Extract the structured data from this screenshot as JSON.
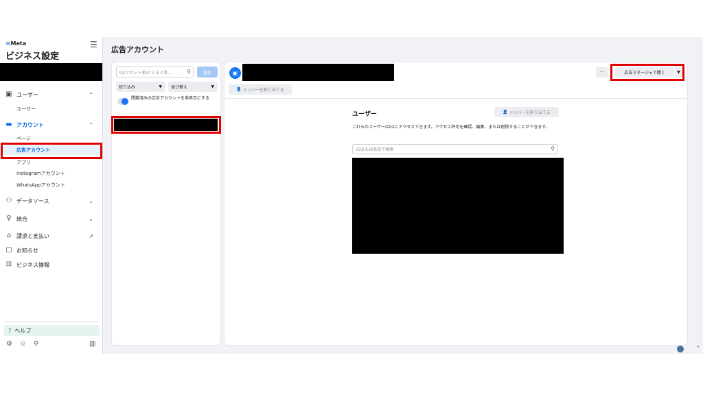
{
  "sidebar": {
    "brand": "Meta",
    "brand_symbol": "∞",
    "title": "ビジネス設定",
    "nav": [
      {
        "label": "ユーザー",
        "icon": "users-icon",
        "expanded": true
      },
      {
        "label": "ユーザー",
        "sub": true
      },
      {
        "label": "アカウント",
        "icon": "folder-icon",
        "expanded": true,
        "active": true
      },
      {
        "label": "ページ",
        "sub": true
      },
      {
        "label": "広告アカウント",
        "sub": true,
        "selected": true
      },
      {
        "label": "アプリ",
        "sub": true
      },
      {
        "label": "Instagramアカウント",
        "sub": true
      },
      {
        "label": "WhatsAppアカウント",
        "sub": true
      },
      {
        "label": "データソース",
        "icon": "data-sources-icon"
      },
      {
        "label": "統合",
        "icon": "integrations-icon"
      },
      {
        "label": "請求と支払い",
        "icon": "bank-icon",
        "external": true
      },
      {
        "label": "お知らせ",
        "icon": "notifications-icon"
      },
      {
        "label": "ビジネス情報",
        "icon": "briefcase-icon"
      }
    ],
    "help": "ヘルプ",
    "help_symbol": "?"
  },
  "header": {
    "title": "広告アカウント"
  },
  "list": {
    "search_placeholder": "ID/アセット名/ビジネス名...",
    "add": "追加",
    "filter": "絞り込み",
    "sort": "並び替え",
    "toggle_label": "閉鎖済みの広告アカウントを非表示にする",
    "toggle_on": true
  },
  "detail": {
    "assign_member": "メンバーを割り当てる",
    "more": "···",
    "open_in_ads_manager": "広告マネージャで開く",
    "users_title": "ユーザー",
    "users_description": "これらのユーザーは02にアクセスできます。アクセス許可を確認、編集、または削除することができます。",
    "user_search_placeholder": "IDまたは名前で検索"
  },
  "colors": {
    "accent": "#1877f2",
    "highlight": "#e00000",
    "redaction": "#000000"
  }
}
